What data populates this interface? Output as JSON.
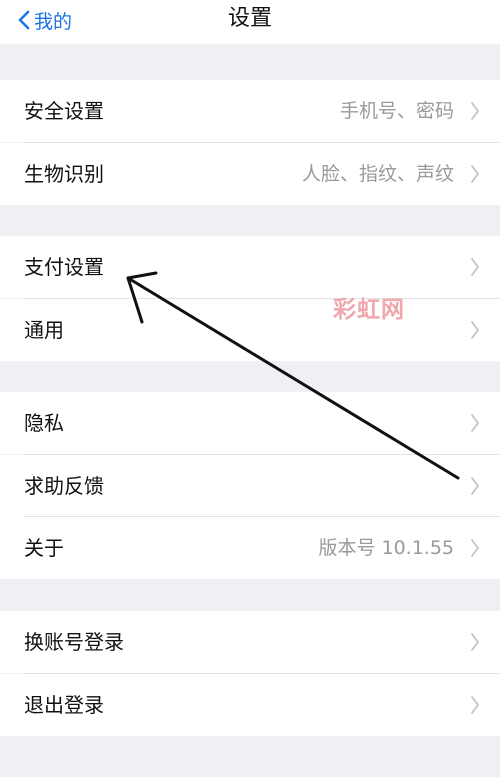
{
  "nav": {
    "back_label": "我的",
    "title": "设置"
  },
  "groups": [
    {
      "items": [
        {
          "id": "security",
          "label": "安全设置",
          "value": "手机号、密码"
        },
        {
          "id": "biometrics",
          "label": "生物识别",
          "value": "人脸、指纹、声纹"
        }
      ]
    },
    {
      "items": [
        {
          "id": "payment",
          "label": "支付设置",
          "value": ""
        },
        {
          "id": "general",
          "label": "通用",
          "value": ""
        }
      ]
    },
    {
      "items": [
        {
          "id": "privacy",
          "label": "隐私",
          "value": ""
        },
        {
          "id": "feedback",
          "label": "求助反馈",
          "value": ""
        },
        {
          "id": "about",
          "label": "关于",
          "value": "版本号 10.1.55"
        }
      ]
    },
    {
      "items": [
        {
          "id": "switch-account",
          "label": "换账号登录",
          "value": ""
        },
        {
          "id": "logout",
          "label": "退出登录",
          "value": ""
        }
      ]
    }
  ],
  "watermark": "彩虹网",
  "colors": {
    "accent": "#1a73e8",
    "background": "#efeff4",
    "secondary_text": "#9a9a9a",
    "watermark": "#f0a7ad"
  }
}
